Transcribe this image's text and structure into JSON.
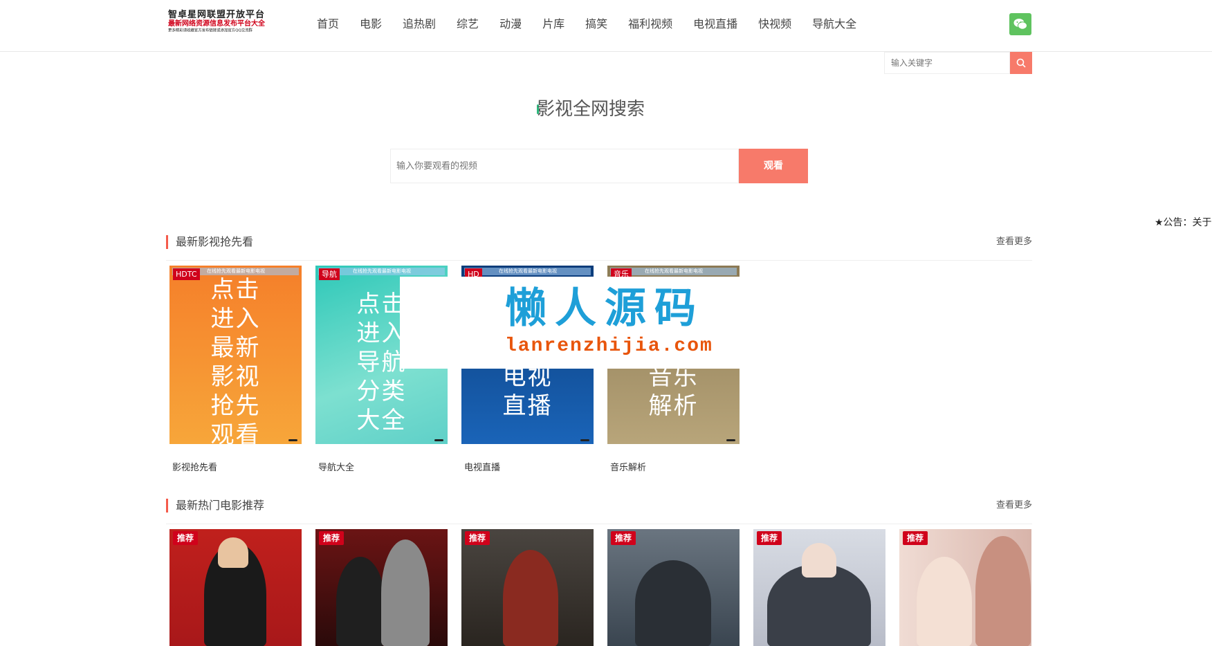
{
  "header": {
    "logo": {
      "line1": "智卓星网联盟开放平台",
      "line2": "最新网络资源信息发布平台大全",
      "line3": "更多精彩请收藏官方发布链接或添加官方QQ交流群"
    },
    "nav": [
      "首页",
      "电影",
      "追热剧",
      "综艺",
      "动漫",
      "片库",
      "搞笑",
      "福利视频",
      "电视直播",
      "快视频",
      "导航大全"
    ],
    "search_placeholder": "输入关键字"
  },
  "hero": {
    "title": "影视全网搜索",
    "input_placeholder": "输入你要观看的视频",
    "button_label": "观看"
  },
  "notice": "★公告：关于",
  "section1": {
    "title": "最新影视抢先看",
    "more": "查看更多",
    "strip_text": "在线抢先观看最新电影电视",
    "cards": [
      {
        "badge": "HDTC",
        "text_lines": "点击进入最新影视抢先观看",
        "caption": "影视抢先看",
        "color1": "#f57f2a",
        "color2": "#f7a63a"
      },
      {
        "badge": "导航",
        "text_lines": "点击进入导航分类大全",
        "caption": "导航大全",
        "color1": "#2ec8b8",
        "color2": "#7de0d0"
      },
      {
        "badge": "HD",
        "text_lines": "电视直播",
        "caption": "电视直播",
        "color1": "#0b3c7a",
        "color2": "#1a64b8"
      },
      {
        "badge": "音乐",
        "text_lines": "音乐解析",
        "caption": "音乐解析",
        "color1": "#8c7a54",
        "color2": "#b8a57a"
      }
    ]
  },
  "section2": {
    "title": "最新热门电影推荐",
    "more": "查看更多",
    "posters": [
      {
        "badge": "推荐",
        "color": "#c0201c"
      },
      {
        "badge": "推荐",
        "color": "#6b1414"
      },
      {
        "badge": "推荐",
        "color": "#3a3530"
      },
      {
        "badge": "推荐",
        "color": "#4a5560"
      },
      {
        "badge": "推荐",
        "color": "#c8ccd4"
      },
      {
        "badge": "推荐",
        "color": "#e4c8c4"
      }
    ]
  },
  "watermark": {
    "title": "懒人源码",
    "url": "lanrenzhijia.com"
  },
  "colors": {
    "accent": "#f77a6a",
    "badge_red": "#d0021b",
    "wechat_green": "#5fc35f",
    "section_bar": "#f45b4b"
  }
}
